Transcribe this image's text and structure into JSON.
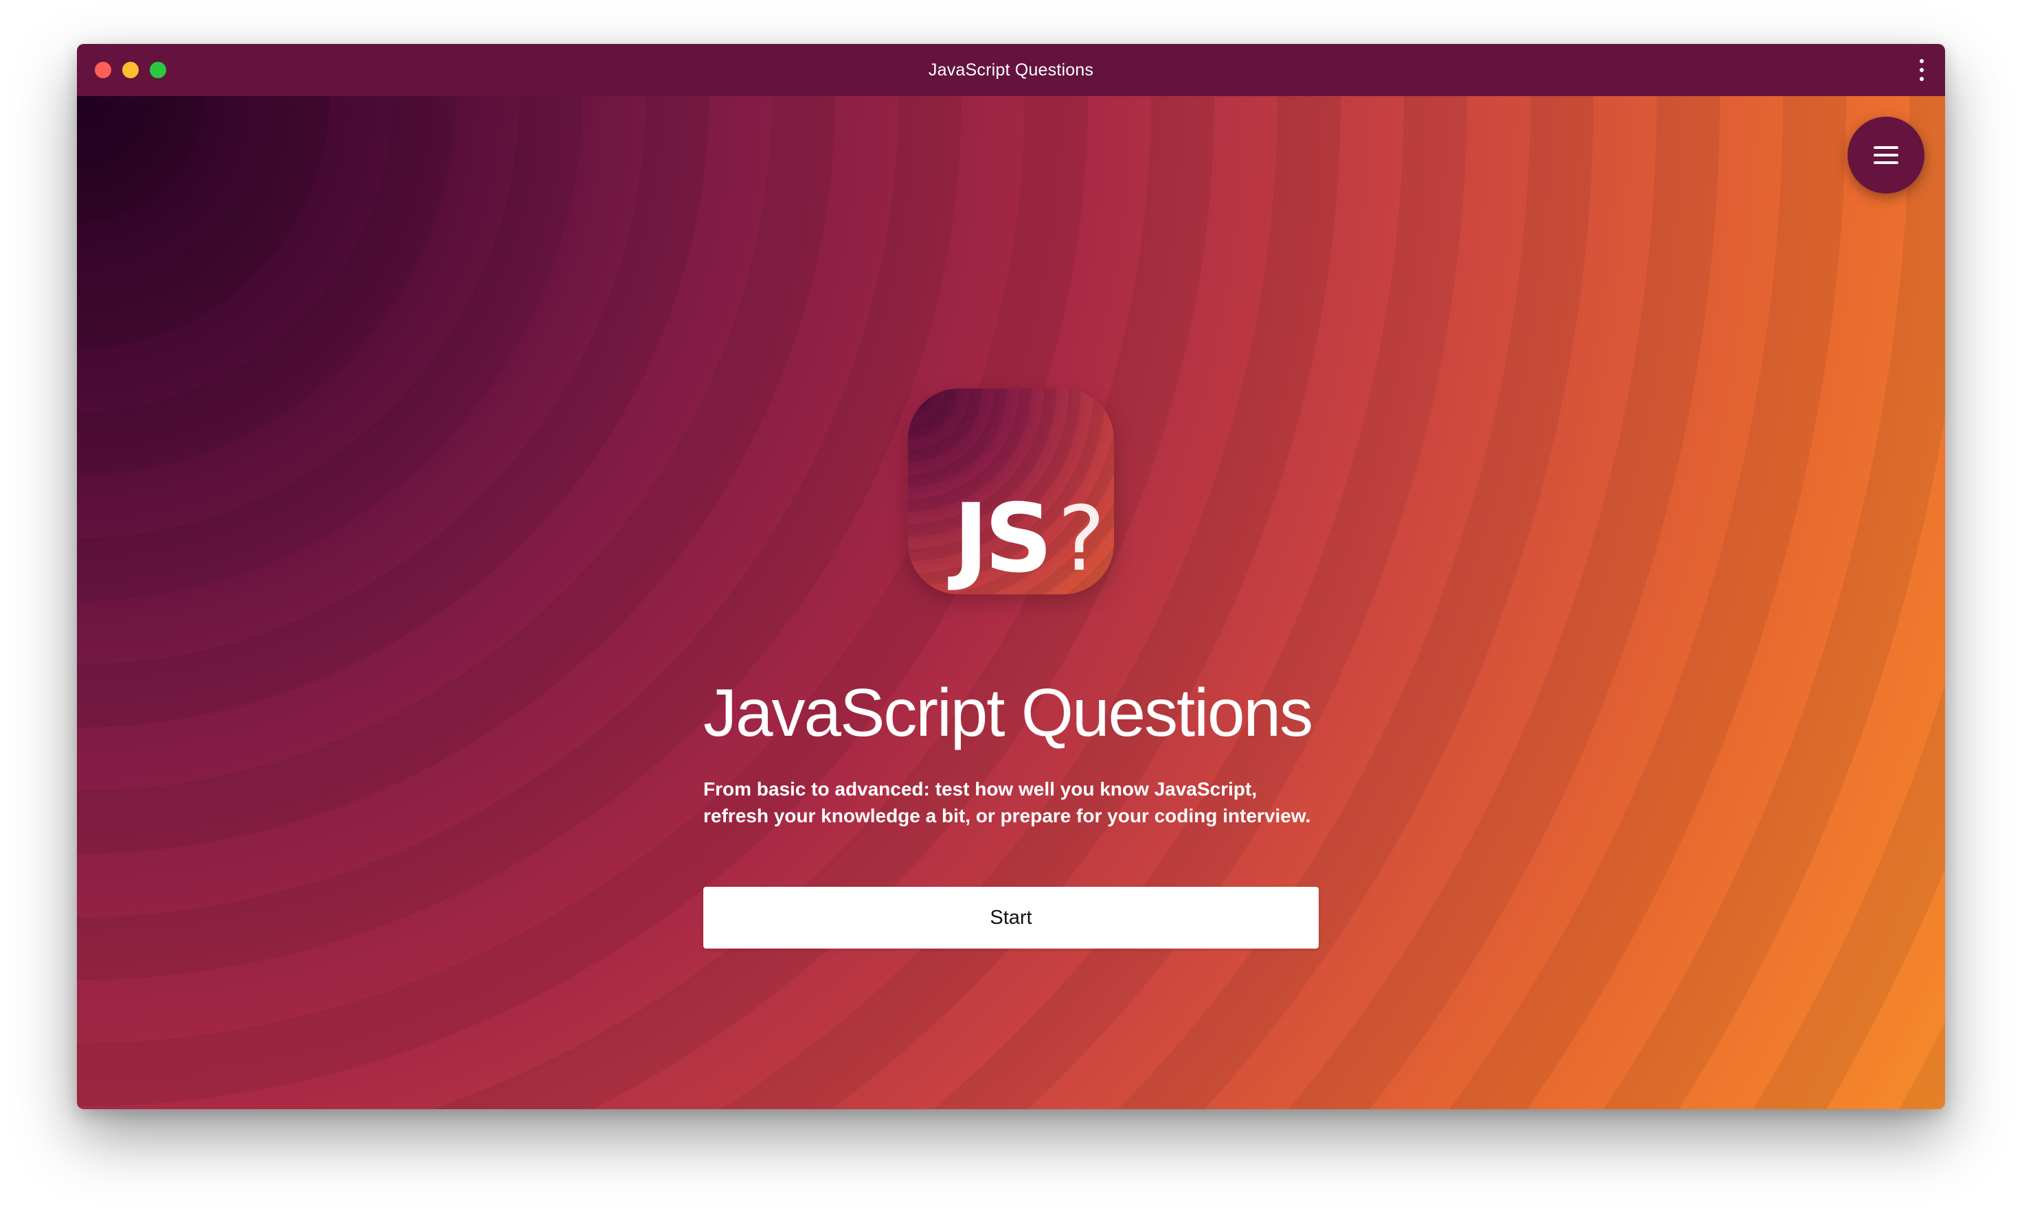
{
  "window": {
    "title": "JavaScript Questions"
  },
  "logo": {
    "js_text": "JS",
    "question_mark": "?"
  },
  "hero": {
    "title": "JavaScript Questions",
    "subtitle": "From basic to advanced: test how well you know JavaScript, refresh your knowledge a bit, or prepare for your coding interview.",
    "start_label": "Start"
  },
  "icons": {
    "fab": "hamburger-menu-icon",
    "titlebar": "kebab-menu-icon"
  },
  "colors": {
    "titlebar": "#64133e",
    "fab": "#66133f",
    "gradient_dark": "#1f0020",
    "gradient_light": "#f9922a",
    "button_bg": "#ffffff"
  }
}
